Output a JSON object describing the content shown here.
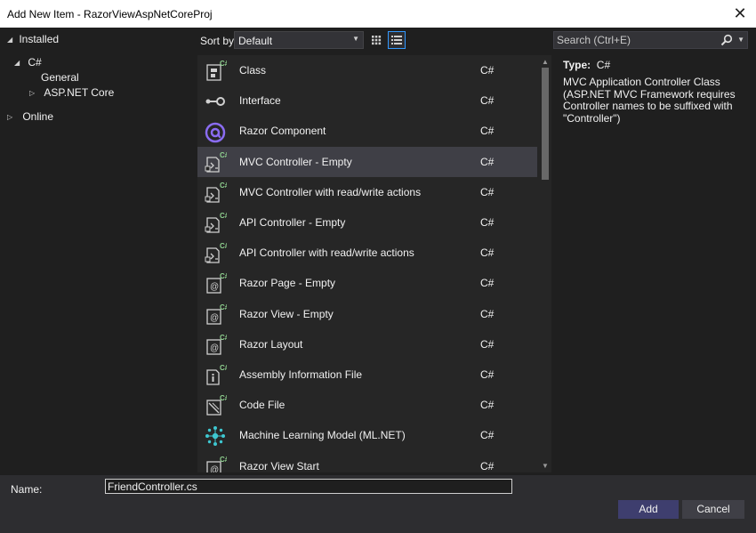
{
  "window": {
    "title": "Add New Item - RazorViewAspNetCoreProj",
    "close_glyph": "✕"
  },
  "tree": {
    "installed": "Installed",
    "csharp": "C#",
    "general": "General",
    "aspnetcore": "ASP.NET Core",
    "online": "Online"
  },
  "toolbar": {
    "sort_label": "Sort by:",
    "sort_value": "Default"
  },
  "search": {
    "placeholder": "Search (Ctrl+E)"
  },
  "templates": [
    {
      "name": "Class",
      "lang": "C#",
      "icon": "class-icon",
      "selected": false
    },
    {
      "name": "Interface",
      "lang": "C#",
      "icon": "interface-icon",
      "selected": false
    },
    {
      "name": "Razor Component",
      "lang": "C#",
      "icon": "razor-component-icon",
      "selected": false
    },
    {
      "name": "MVC Controller - Empty",
      "lang": "C#",
      "icon": "controller-icon",
      "selected": true
    },
    {
      "name": "MVC Controller with read/write actions",
      "lang": "C#",
      "icon": "controller-icon",
      "selected": false
    },
    {
      "name": "API Controller - Empty",
      "lang": "C#",
      "icon": "controller-icon",
      "selected": false
    },
    {
      "name": "API Controller with read/write actions",
      "lang": "C#",
      "icon": "controller-icon",
      "selected": false
    },
    {
      "name": "Razor Page - Empty",
      "lang": "C#",
      "icon": "razor-page-icon",
      "selected": false
    },
    {
      "name": "Razor View - Empty",
      "lang": "C#",
      "icon": "razor-page-icon",
      "selected": false
    },
    {
      "name": "Razor Layout",
      "lang": "C#",
      "icon": "razor-page-icon",
      "selected": false
    },
    {
      "name": "Assembly Information File",
      "lang": "C#",
      "icon": "info-file-icon",
      "selected": false
    },
    {
      "name": "Code File",
      "lang": "C#",
      "icon": "code-file-icon",
      "selected": false
    },
    {
      "name": "Machine Learning Model (ML.NET)",
      "lang": "C#",
      "icon": "ml-model-icon",
      "selected": false
    },
    {
      "name": "Razor View Start",
      "lang": "C#",
      "icon": "razor-page-icon",
      "selected": false
    }
  ],
  "details": {
    "type_label": "Type:",
    "type_value": "C#",
    "description": "MVC Application Controller Class (ASP.NET MVC Framework requires Controller names to be suffixed with \"Controller\")"
  },
  "footer": {
    "name_label": "Name:",
    "name_value": "FriendController.cs",
    "add_label": "Add",
    "cancel_label": "Cancel"
  },
  "colors": {
    "accent": "#3399ff",
    "razor_purple": "#8a6cf1",
    "ml_teal": "#3ec7d0",
    "badge_green": "#8fd18f",
    "add_button": "#3e3e6e"
  }
}
